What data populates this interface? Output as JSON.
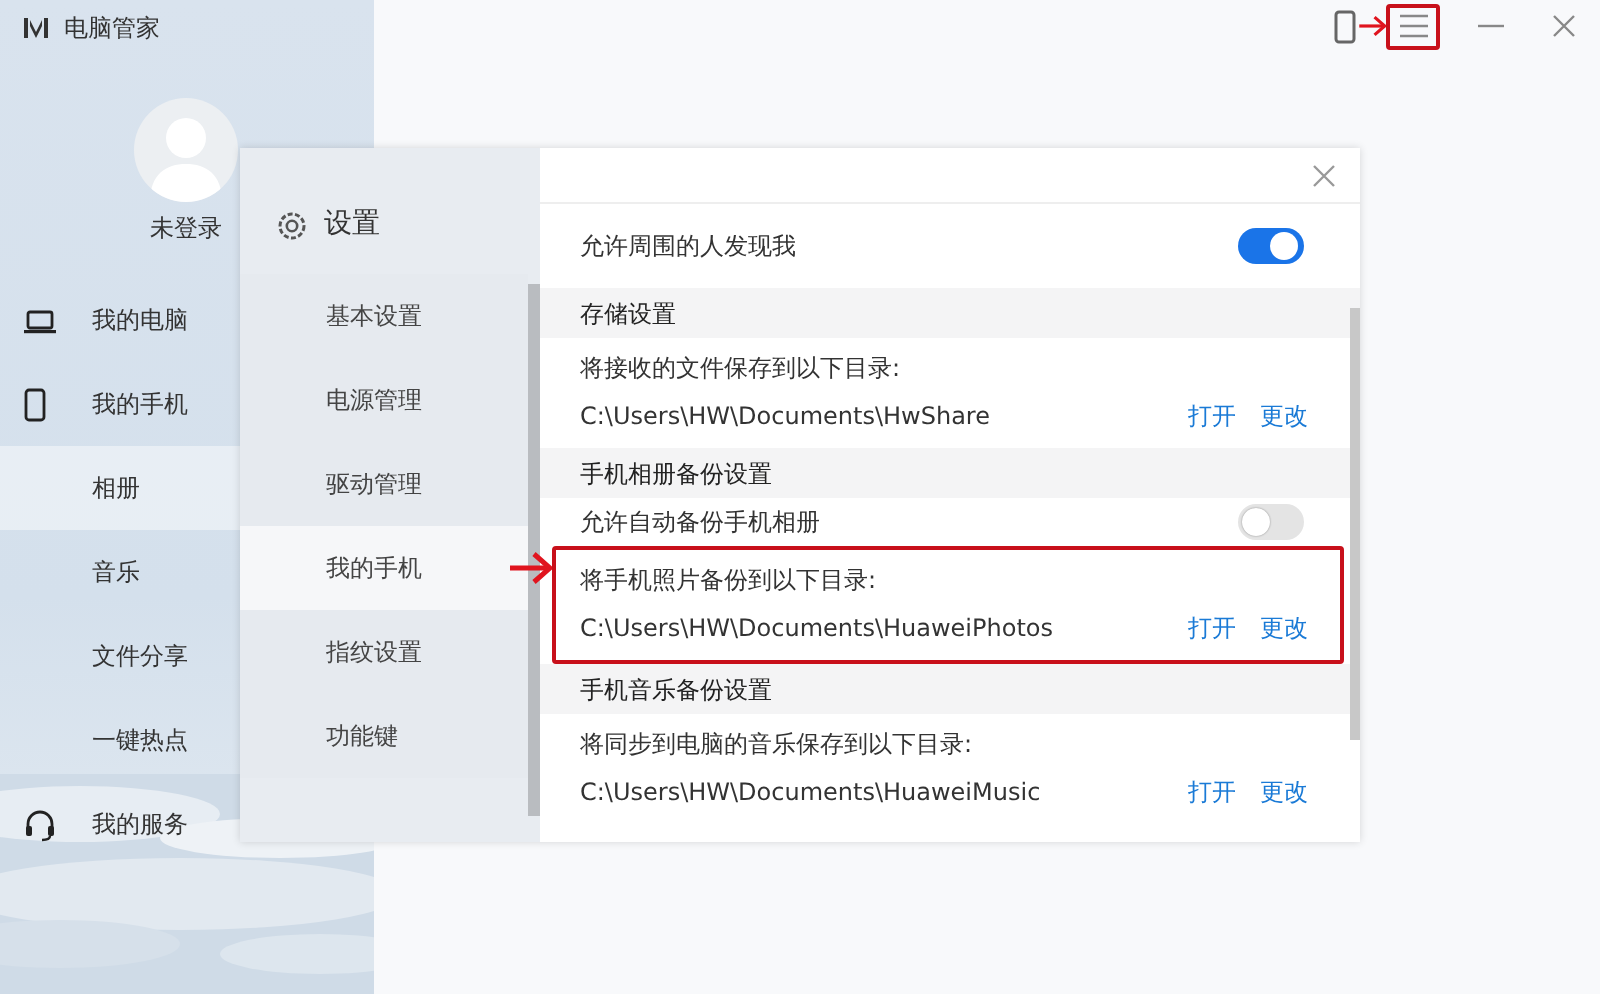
{
  "app": {
    "title": "电脑管家"
  },
  "titlebar": {
    "menu_annotated": true
  },
  "user": {
    "name": "未登录"
  },
  "sidebar": {
    "items": [
      {
        "label": "我的电脑",
        "selected": false
      },
      {
        "label": "我的手机",
        "selected": false
      },
      {
        "label": "相册",
        "selected": true
      },
      {
        "label": "音乐",
        "selected": false
      },
      {
        "label": "文件分享",
        "selected": false
      },
      {
        "label": "一键热点",
        "selected": false
      },
      {
        "label": "我的服务",
        "selected": false
      }
    ]
  },
  "dialog": {
    "title": "设置",
    "nav": [
      {
        "label": "基本设置",
        "selected": false
      },
      {
        "label": "电源管理",
        "selected": false
      },
      {
        "label": "驱动管理",
        "selected": false
      },
      {
        "label": "我的手机",
        "selected": true
      },
      {
        "label": "指纹设置",
        "selected": false
      },
      {
        "label": "功能键",
        "selected": false
      }
    ],
    "settings": [
      {
        "kind": "toggle",
        "label": "允许周围的人发现我",
        "on": true
      },
      {
        "kind": "section",
        "label": "存储设置"
      },
      {
        "kind": "path",
        "label": "将接收的文件保存到以下目录:",
        "path": "C:\\Users\\HW\\Documents\\HwShare",
        "actions": [
          "打开",
          "更改"
        ],
        "annotated": false
      },
      {
        "kind": "section",
        "label": "手机相册备份设置"
      },
      {
        "kind": "toggle",
        "label": "允许自动备份手机相册",
        "on": false
      },
      {
        "kind": "path",
        "label": "将手机照片备份到以下目录:",
        "path": "C:\\Users\\HW\\Documents\\HuaweiPhotos",
        "actions": [
          "打开",
          "更改"
        ],
        "annotated": true
      },
      {
        "kind": "section",
        "label": "手机音乐备份设置"
      },
      {
        "kind": "path",
        "label": "将同步到电脑的音乐保存到以下目录:",
        "path": "C:\\Users\\HW\\Documents\\HuaweiMusic",
        "actions": [
          "打开",
          "更改"
        ],
        "annotated": false
      }
    ]
  }
}
